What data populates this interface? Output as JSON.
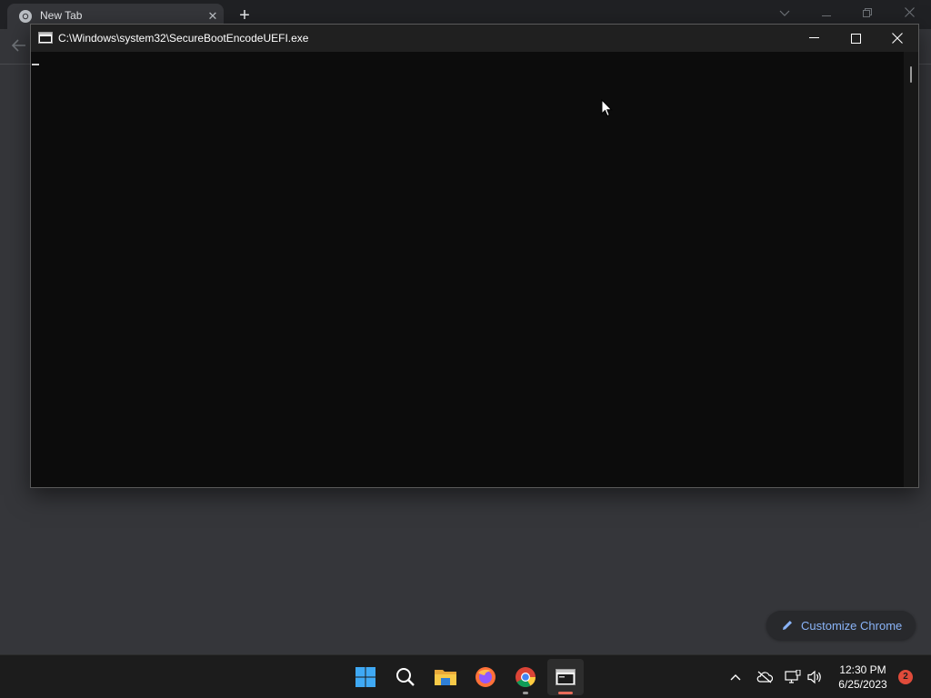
{
  "chrome": {
    "tab": {
      "title": "New Tab",
      "icon": "chrome-icon",
      "close_icon": "close-icon"
    },
    "new_tab_icon": "plus-icon",
    "window_controls": [
      "chevron-down-icon",
      "minimize-icon",
      "restore-icon",
      "close-icon"
    ],
    "back_icon": "back-arrow-icon",
    "customize_button": {
      "label": "Customize Chrome",
      "icon": "pencil-icon",
      "color": "#8ab4f8"
    }
  },
  "console": {
    "title": "C:\\Windows\\system32\\SecureBootEncodeUEFI.exe",
    "output": "",
    "background": "#0c0c0c",
    "window_controls": [
      "minimize-icon",
      "maximize-icon",
      "close-icon"
    ]
  },
  "taskbar": {
    "apps": [
      {
        "name": "start",
        "icon": "windows-start-icon"
      },
      {
        "name": "search",
        "icon": "search-icon"
      },
      {
        "name": "file-explorer",
        "icon": "folder-icon"
      },
      {
        "name": "firefox",
        "icon": "firefox-icon"
      },
      {
        "name": "chrome",
        "icon": "chrome-icon",
        "running": true
      },
      {
        "name": "console",
        "icon": "console-app-icon",
        "active": true
      }
    ],
    "tray": {
      "icons": [
        "chevron-up-icon",
        "cloud-offline-icon",
        "network-icon",
        "volume-icon"
      ],
      "time": "12:30 PM",
      "date": "6/25/2023",
      "notification_count": "2"
    }
  }
}
